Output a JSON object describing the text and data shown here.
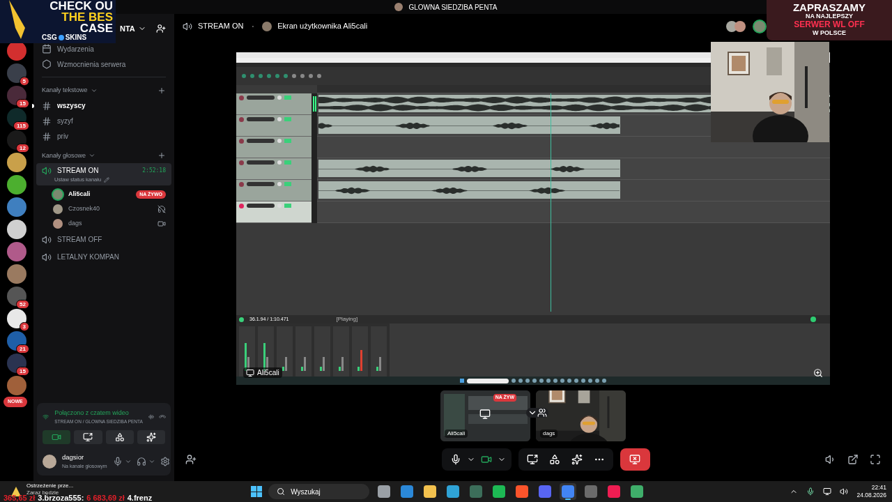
{
  "overlays": {
    "promo_left": {
      "lines": [
        "CHECK OU",
        "THE BES",
        "CASE"
      ],
      "brand": "CSG",
      "brand_suffix": "SKINS"
    },
    "promo_right": {
      "lines": [
        "ZAPRASZAMY",
        "NA NAJLEPSZY",
        "SERWER WL OFF",
        "W POLSCE"
      ]
    },
    "ticker": [
      {
        "text": "365,65 zł",
        "kind": "amount"
      },
      {
        "text": "3.brzoza555:",
        "kind": "name"
      },
      {
        "text": "6 683,69 zł",
        "kind": "amount"
      },
      {
        "text": "4.frenz",
        "kind": "name"
      }
    ]
  },
  "top": {
    "title": "GLOWNA SIEDZIBA PENTA",
    "channel": "STREAM ON",
    "separator": "•",
    "stream_title": "Ekran użytkownika Ali5cali"
  },
  "servers": [
    {
      "color": "#d32f2f"
    },
    {
      "color": "#3a3f4a",
      "badge": "5"
    },
    {
      "color": "#4a2a3a",
      "badge": "15"
    },
    {
      "color": "#0f2a2a",
      "badge": "115"
    },
    {
      "color": "#1a1a1a",
      "badge": "12"
    },
    {
      "color": "#c9a04a"
    },
    {
      "color": "#4caf2f"
    },
    {
      "color": "#3f7fbf"
    },
    {
      "color": "#d0d0d0"
    },
    {
      "color": "#b05a8a"
    },
    {
      "color": "#9a7a60"
    },
    {
      "color": "#555555",
      "badge": "52"
    },
    {
      "color": "#e8e8e8",
      "badge": "3"
    },
    {
      "color": "#1f5fa8",
      "badge": "21"
    },
    {
      "color": "#2a3350",
      "badge": "15"
    },
    {
      "color": "#a0603a"
    }
  ],
  "new_badge": "NOWE",
  "sidebar": {
    "server_name": "NTA",
    "shortcuts": [
      {
        "label": "Wydarzenia",
        "kind": "events"
      },
      {
        "label": "Wzmocnienia serwera",
        "kind": "boosts"
      }
    ],
    "text_category": "Kanały tekstowe",
    "text_channels": [
      {
        "name": "wszyscy",
        "unread": true
      },
      {
        "name": "syzyf",
        "unread": false
      },
      {
        "name": "priv",
        "unread": false
      }
    ],
    "voice_category": "Kanały głosowe",
    "voice_channels": [
      {
        "name": "STREAM ON",
        "selected": true,
        "timer": "2:52:18",
        "status": "Ustaw status kanału",
        "members": [
          {
            "name": "Ali5cali",
            "live": true,
            "badge": "NA ŻYWO",
            "kind": "streaming"
          },
          {
            "name": "Czosnek40",
            "live": false,
            "kind": "deafened"
          },
          {
            "name": "dags",
            "live": false,
            "kind": "camera"
          }
        ]
      },
      {
        "name": "STREAM OFF",
        "selected": false
      },
      {
        "name": "LETALNY KOMPAN",
        "selected": false
      }
    ]
  },
  "voice_panel": {
    "status": "Połączono z czatem wideo",
    "channel": "STREAM ON / GLOWNA SIEDZIBA PENTA",
    "buttons": [
      {
        "kind": "camera",
        "on": true
      },
      {
        "kind": "screen",
        "on": false
      },
      {
        "kind": "activities",
        "on": false
      },
      {
        "kind": "soundboard",
        "on": false
      }
    ]
  },
  "user": {
    "name": "dagsior",
    "status": "Na kanale głosowym"
  },
  "notification": {
    "title": "Ostrzeżenie prze...",
    "text": "Zaraz będzie"
  },
  "stream": {
    "owner": "Ali5cali",
    "position": "36.1.94 / 1:10.471",
    "state": "[Playing]",
    "tracks": [
      {
        "kind": "stereo",
        "armed": false
      },
      {
        "kind": "mono",
        "armed": false
      },
      {
        "kind": "empty",
        "armed": false
      },
      {
        "kind": "mono",
        "armed": false
      },
      {
        "kind": "mono",
        "armed": false
      },
      {
        "kind": "empty",
        "armed": true
      }
    ]
  },
  "tiles": [
    {
      "kind": "screen",
      "name": "Ali5cali",
      "badge": "NA ŻYW"
    },
    {
      "kind": "camera",
      "name": "dags"
    }
  ],
  "controls": {
    "mic_on": true,
    "camera_on": true
  },
  "taskbar": {
    "search": "Wyszukaj",
    "time": "22:41",
    "date": "24.08.2026",
    "apps": [
      {
        "color": "#9aa0a6",
        "selected": false
      },
      {
        "color": "#2b88d8",
        "selected": false
      },
      {
        "color": "#f2c14e",
        "selected": false
      },
      {
        "color": "#2fa3d6",
        "selected": false
      },
      {
        "color": "#3c6e5a",
        "selected": false
      },
      {
        "color": "#1db954",
        "selected": false
      },
      {
        "color": "#fb542b",
        "selected": false
      },
      {
        "color": "#5865f2",
        "selected": false
      },
      {
        "color": "#4285f4",
        "selected": true
      },
      {
        "color": "#6b6b6b",
        "selected": false
      },
      {
        "color": "#ee1d52",
        "selected": false
      },
      {
        "color": "#3fae6a",
        "selected": false
      }
    ]
  }
}
